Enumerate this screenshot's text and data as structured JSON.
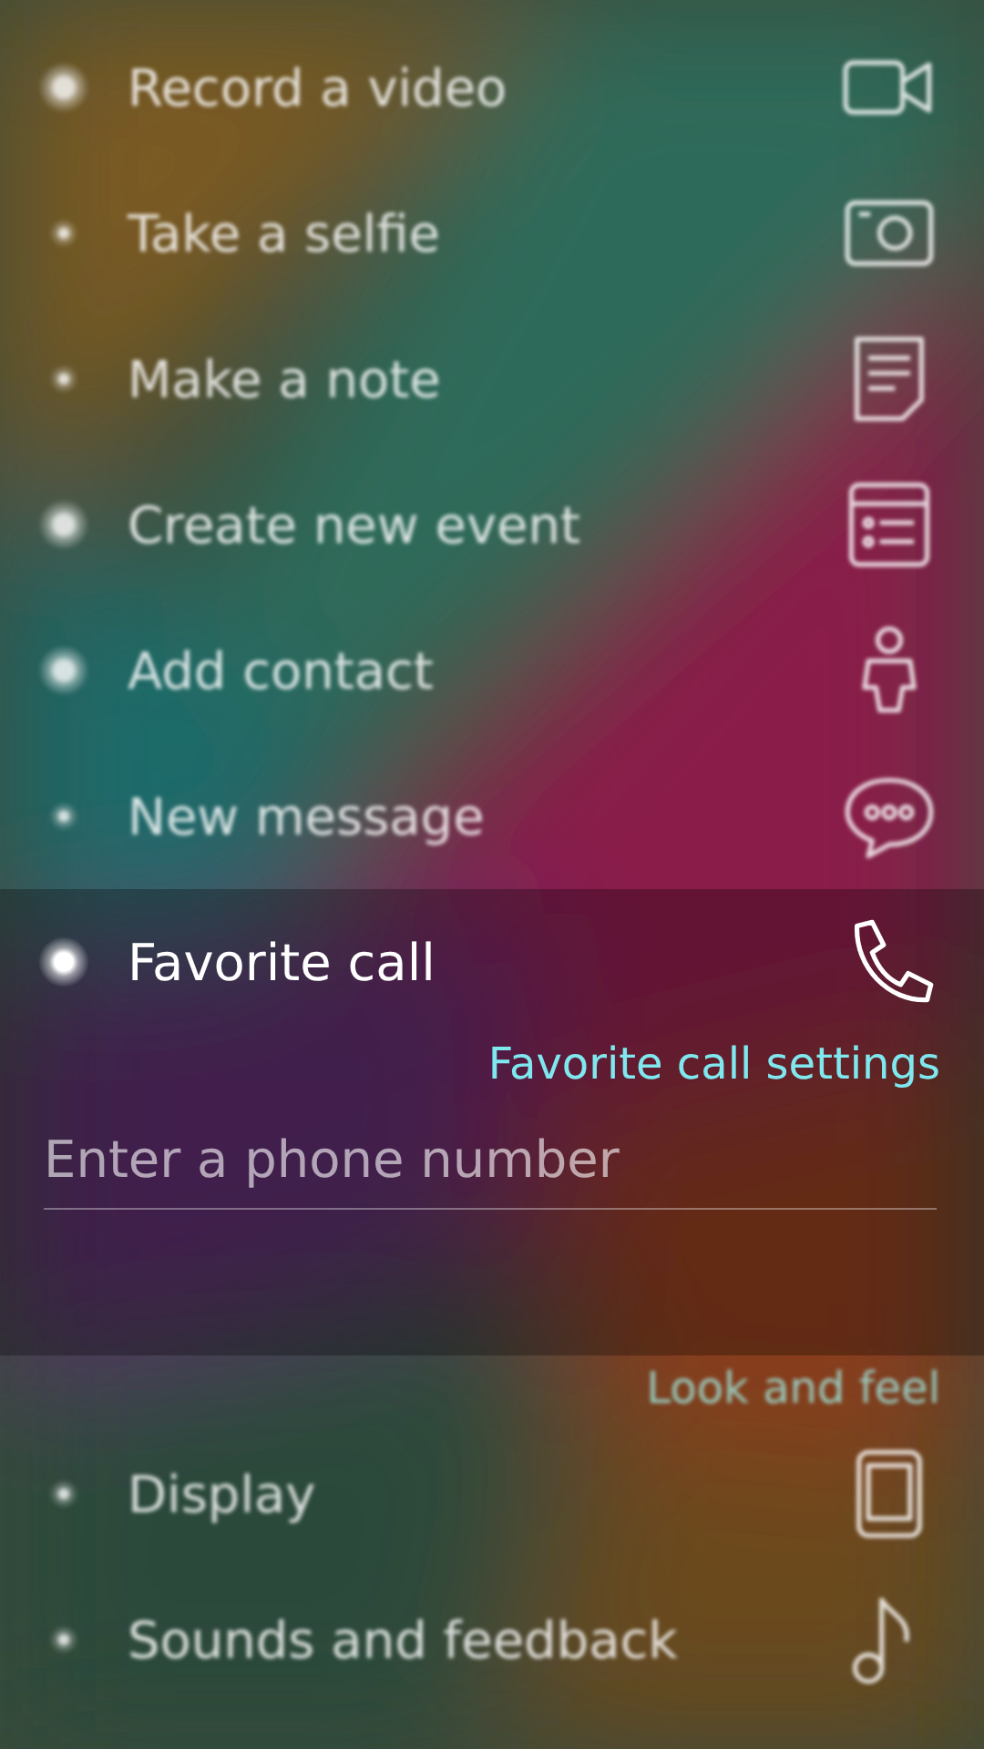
{
  "shortcuts": [
    {
      "label": "Record a video",
      "kind": "video",
      "highlighted": true,
      "focused": false
    },
    {
      "label": "Take a selfie",
      "kind": "camera",
      "highlighted": false,
      "focused": false
    },
    {
      "label": "Make a note",
      "kind": "note",
      "highlighted": false,
      "focused": false
    },
    {
      "label": "Create new event",
      "kind": "event",
      "highlighted": true,
      "focused": false
    },
    {
      "label": "Add contact",
      "kind": "person",
      "highlighted": true,
      "focused": false
    },
    {
      "label": "New message",
      "kind": "message",
      "highlighted": false,
      "focused": false
    },
    {
      "label": "Favorite call",
      "kind": "phone",
      "highlighted": true,
      "focused": true
    }
  ],
  "favorite_call_menu": {
    "link": "Favorite call settings",
    "phone_field": {
      "placeholder": "Enter a phone number"
    }
  },
  "section_header": "Look and feel",
  "settings": [
    {
      "label": "Display",
      "kind": "display",
      "highlighted": false
    },
    {
      "label": "Sounds and feedback",
      "kind": "music",
      "highlighted": false
    }
  ]
}
